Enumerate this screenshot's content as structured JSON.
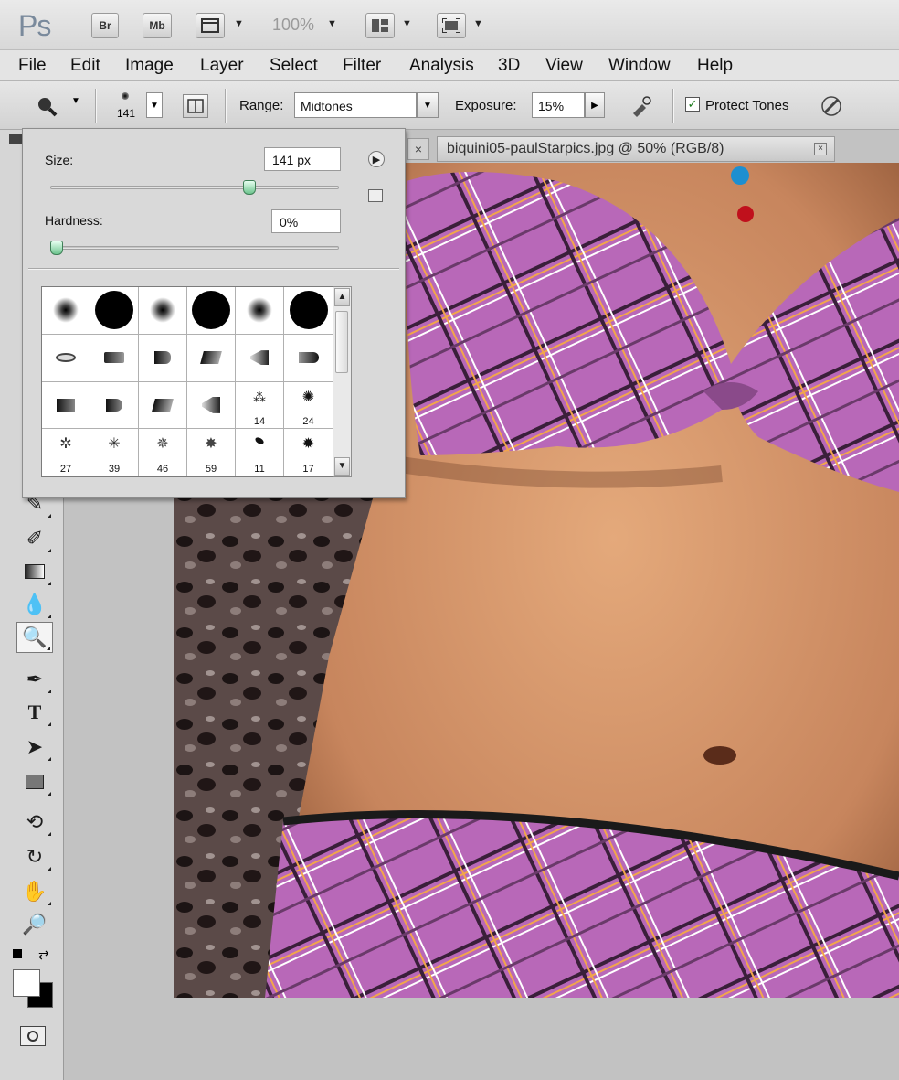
{
  "app": {
    "logo": "Ps",
    "bridge_label": "Br",
    "mini_bridge_label": "Mb",
    "zoom": "100%"
  },
  "menu": [
    "File",
    "Edit",
    "Image",
    "Layer",
    "Select",
    "Filter",
    "Analysis",
    "3D",
    "View",
    "Window",
    "Help"
  ],
  "options": {
    "brush_size": "141",
    "range_label": "Range:",
    "range_value": "Midtones",
    "exposure_label": "Exposure:",
    "exposure_value": "15%",
    "protect_tones_label": "Protect Tones",
    "protect_tones_checked": true
  },
  "document": {
    "tab_title": "biquini05-paulStarpics.jpg @ 50% (RGB/8)"
  },
  "brush_picker": {
    "size_label": "Size:",
    "size_value": "141 px",
    "size_level": 0.7,
    "hardness_label": "Hardness:",
    "hardness_value": "0%",
    "hardness_level": 0.0,
    "brush_numbers": [
      "",
      "",
      "",
      "",
      "",
      "",
      "",
      "",
      "",
      "",
      "",
      "",
      "",
      "",
      "",
      "",
      "14",
      "24",
      "27",
      "39",
      "46",
      "59",
      "11",
      "17"
    ]
  },
  "colors": {
    "accent_thumb": "#6cc48d",
    "bikini": "#b565b5",
    "skin": "#d79a70",
    "fabric_red": "#b3141c"
  }
}
